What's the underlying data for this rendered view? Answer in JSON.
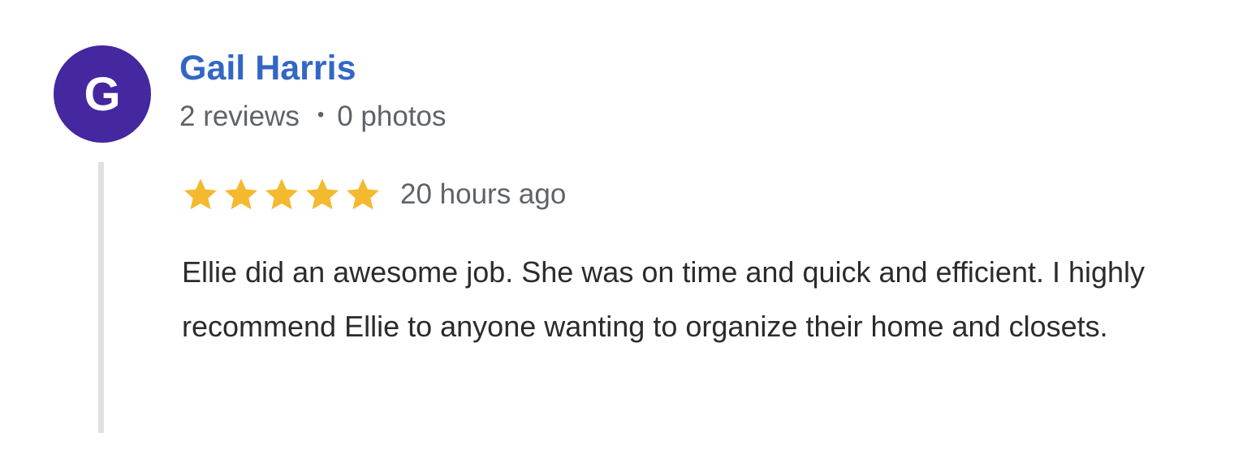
{
  "reviewer": {
    "initial": "G",
    "name": "Gail Harris",
    "reviews": "2 reviews",
    "separator": "•",
    "photos": "0 photos",
    "avatar_color": "#4527a0"
  },
  "review": {
    "rating": 5,
    "max_rating": 5,
    "star_color": "#f4b92f",
    "timestamp": "20 hours ago",
    "text": "Ellie did an awesome job. She was on time and quick and efficient. I highly recommend Ellie to anyone wanting to organize their home and closets."
  }
}
